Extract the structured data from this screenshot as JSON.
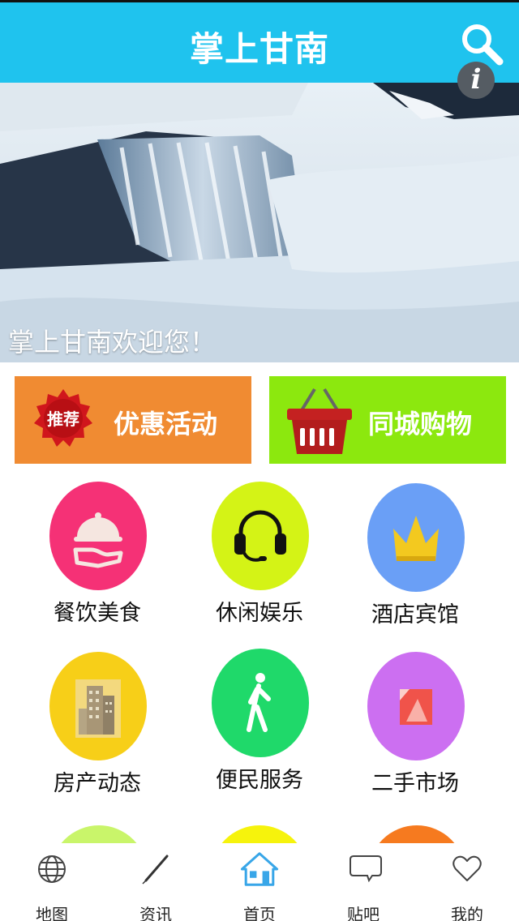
{
  "header": {
    "title": "掌上甘南",
    "search_icon": "search-icon",
    "info_icon": "info-icon",
    "info_glyph": "i",
    "bg_color": "#1fc3ee"
  },
  "banner": {
    "caption": "掌上甘南欢迎您！",
    "image": "waterfall-photo"
  },
  "promos": [
    {
      "label": "优惠活动",
      "icon": "recommend-badge-icon",
      "badge_text": "推荐",
      "color": "#f08b32"
    },
    {
      "label": "同城购物",
      "icon": "shopping-basket-icon",
      "color": "#8ce80e"
    }
  ],
  "categories": [
    {
      "label": "餐饮美食",
      "icon": "serving-tray-icon",
      "color": "#f53176"
    },
    {
      "label": "休闲娱乐",
      "icon": "headset-icon",
      "color": "#d4f316"
    },
    {
      "label": "酒店宾馆",
      "icon": "crown-icon",
      "color": "#6a9ff6"
    },
    {
      "label": "房产动态",
      "icon": "building-icon",
      "color": "#f7cf18"
    },
    {
      "label": "便民服务",
      "icon": "walking-person-icon",
      "color": "#1fd96a"
    },
    {
      "label": "二手市场",
      "icon": "tag-icon",
      "color": "#cc6ff1"
    }
  ],
  "partial_row_colors": [
    "#c9f56a",
    "#f6f30c",
    "#f67a1f"
  ],
  "tabbar": {
    "items": [
      {
        "label": "地图",
        "icon": "globe-icon",
        "active": false
      },
      {
        "label": "资讯",
        "icon": "pen-icon",
        "active": false
      },
      {
        "label": "首页",
        "icon": "home-icon",
        "active": true
      },
      {
        "label": "贴吧",
        "icon": "chat-bubble-icon",
        "active": false
      },
      {
        "label": "我的",
        "icon": "heart-icon",
        "active": false
      }
    ],
    "active_color": "#38a6e8"
  }
}
